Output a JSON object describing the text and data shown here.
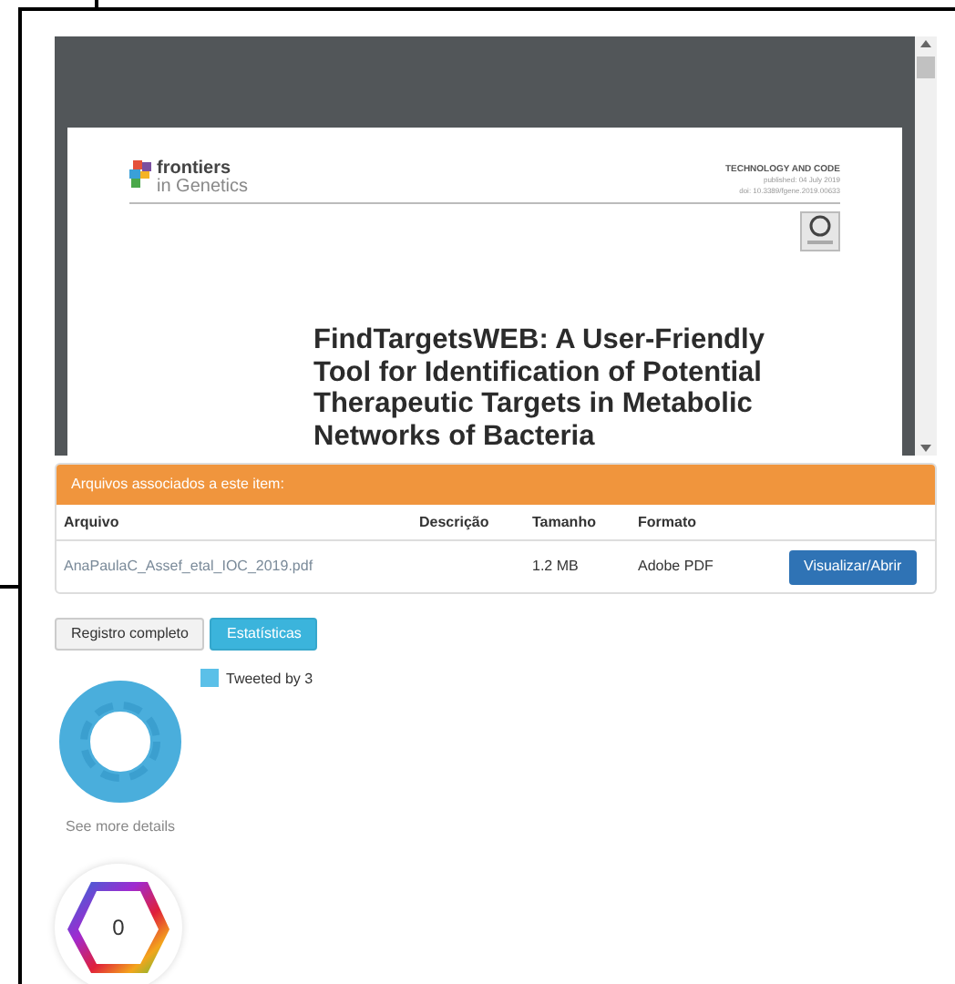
{
  "pdf_viewer": {
    "journal": {
      "name": "frontiers",
      "subtitle": "in Genetics"
    },
    "header": [
      "TECHNOLOGY AND CODE",
      "published: 04 July 2019",
      "doi: 10.3389/fgene.2019.00633"
    ],
    "title_lines": [
      "FindTargetsWEB: A User-Friendly",
      "Tool for Identification of Potential",
      "Therapeutic Targets in Metabolic",
      "Networks of Bacteria"
    ]
  },
  "files": {
    "heading": "Arquivos associados a este item:",
    "columns": [
      "Arquivo",
      "Descrição",
      "Tamanho",
      "Formato"
    ],
    "rows": [
      {
        "file": "AnaPaulaC_Assef_etal_IOC_2019.pdf",
        "size": "1.2 MB",
        "format": "Adobe PDF",
        "action": "Visualizar/Abrir"
      }
    ]
  },
  "tabs": [
    {
      "label": "Registro completo",
      "selected": false
    },
    {
      "label": "Estatísticas",
      "selected": true
    }
  ],
  "altmetric": {
    "legend": "Tweeted by 3",
    "link": "See more details"
  },
  "dimensions": {
    "count": "0"
  }
}
